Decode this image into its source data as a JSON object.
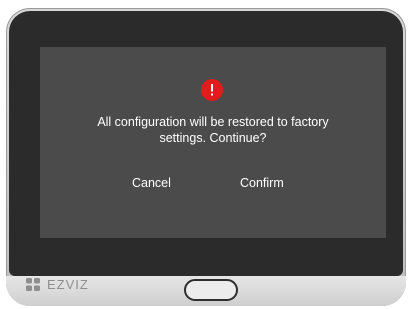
{
  "dialog": {
    "message": "All configuration will be restored to factory\nsettings. Continue?",
    "icon": "alert-circle-icon",
    "buttons": {
      "cancel_label": "Cancel",
      "confirm_label": "Confirm"
    }
  },
  "device": {
    "brand": "EZVIZ"
  },
  "colors": {
    "screen": "#4b4b4b",
    "bezel": "#2b2b2b",
    "alert": "#e21c1c",
    "text": "#ffffff"
  }
}
